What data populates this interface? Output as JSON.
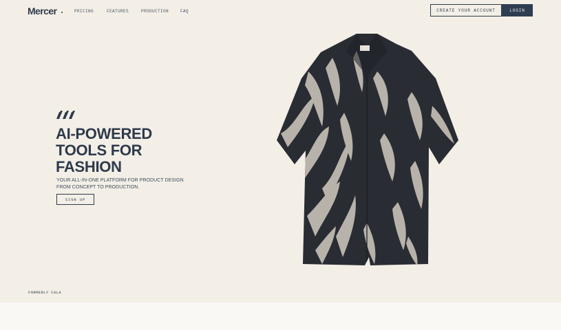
{
  "header": {
    "logo": "Mercer",
    "nav": [
      "PRICING",
      "FEATURES",
      "PRODUCTION",
      "FAQ"
    ],
    "create_account": "CREATE YOUR ACCOUNT",
    "login": "LOGIN"
  },
  "hero": {
    "headline_lines": [
      "AI-POWERED",
      "TOOLS FOR",
      "FASHION"
    ],
    "subtext_lines": [
      "YOUR ALL-IN-ONE PLATFORM FOR PRODUCT DESIGN",
      "FROM CONCEPT TO PRODUCTION."
    ],
    "cta": "SIGN UP",
    "product_icon": "zebra-print-shirt-dress-image",
    "marks_icon": "brand-slash-marks-icon"
  },
  "footer_note": "FORMERLY CALA",
  "colors": {
    "background": "#f3efe7",
    "ink": "#2e3a4b",
    "login_bg": "#2e3d52",
    "below_fold": "#f9f8f5"
  }
}
